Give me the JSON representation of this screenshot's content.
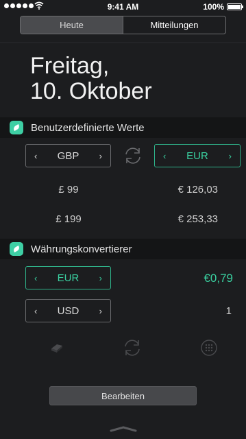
{
  "status_bar": {
    "time": "9:41 AM",
    "battery": "100%"
  },
  "segments": [
    {
      "label": "Heute"
    },
    {
      "label": "Mitteilungen"
    }
  ],
  "date": {
    "weekday": "Freitag,",
    "day": "10. Oktober"
  },
  "custom_values_widget": {
    "title": "Benutzerdefinierte Werte",
    "from_currency": "GBP",
    "to_currency": "EUR",
    "rows": [
      {
        "from": "£ 99",
        "to": "€ 126,03"
      },
      {
        "from": "£ 199",
        "to": "€ 253,33"
      }
    ]
  },
  "converter_widget": {
    "title": "Währungskonvertierer",
    "primary_currency": "EUR",
    "primary_value": "€0,79",
    "secondary_currency": "USD",
    "secondary_value": "1"
  },
  "edit_label": "Bearbeiten",
  "chevron_left": "‹",
  "chevron_right": "›",
  "colors": {
    "accent": "#3ad1a1",
    "background": "#1c1d1f"
  },
  "icons": [
    "wifi-icon",
    "battery-icon",
    "app-icon",
    "swap-icon",
    "eraser-icon",
    "keypad-icon",
    "grabber-icon"
  ]
}
